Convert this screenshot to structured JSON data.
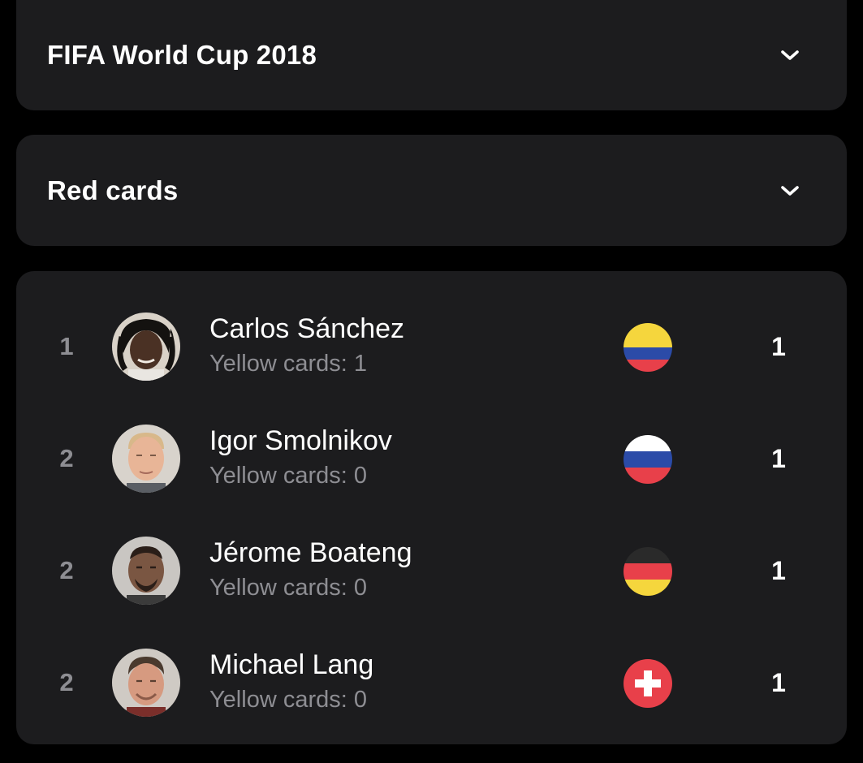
{
  "tournament_selector": {
    "label": "FIFA World Cup 2018",
    "icon": "chevron-down-icon"
  },
  "stat_selector": {
    "label": "Red cards",
    "icon": "chevron-down-icon"
  },
  "players": [
    {
      "rank": "1",
      "name": "Carlos Sánchez",
      "yellow_cards": "Yellow cards: 1",
      "country_flag": "colombia-flag",
      "flag_colors": [
        "#f5d63d",
        "#2b4ba8",
        "#e8404a"
      ],
      "red_cards": "1"
    },
    {
      "rank": "2",
      "name": "Igor Smolnikov",
      "yellow_cards": "Yellow cards: 0",
      "country_flag": "russia-flag",
      "flag_colors": [
        "#ffffff",
        "#2b4ba8",
        "#e8404a"
      ],
      "red_cards": "1"
    },
    {
      "rank": "2",
      "name": "Jérome Boateng",
      "yellow_cards": "Yellow cards: 0",
      "country_flag": "germany-flag",
      "flag_colors": [
        "#2a2a2a",
        "#e8404a",
        "#f5d63d"
      ],
      "red_cards": "1"
    },
    {
      "rank": "2",
      "name": "Michael Lang",
      "yellow_cards": "Yellow cards: 0",
      "country_flag": "switzerland-flag",
      "flag_colors": [
        "#e8404a",
        "#ffffff"
      ],
      "red_cards": "1"
    }
  ],
  "colors": {
    "background": "#000000",
    "panel": "#1c1c1e",
    "primary_text": "#ffffff",
    "secondary_text": "#8e8e93"
  }
}
